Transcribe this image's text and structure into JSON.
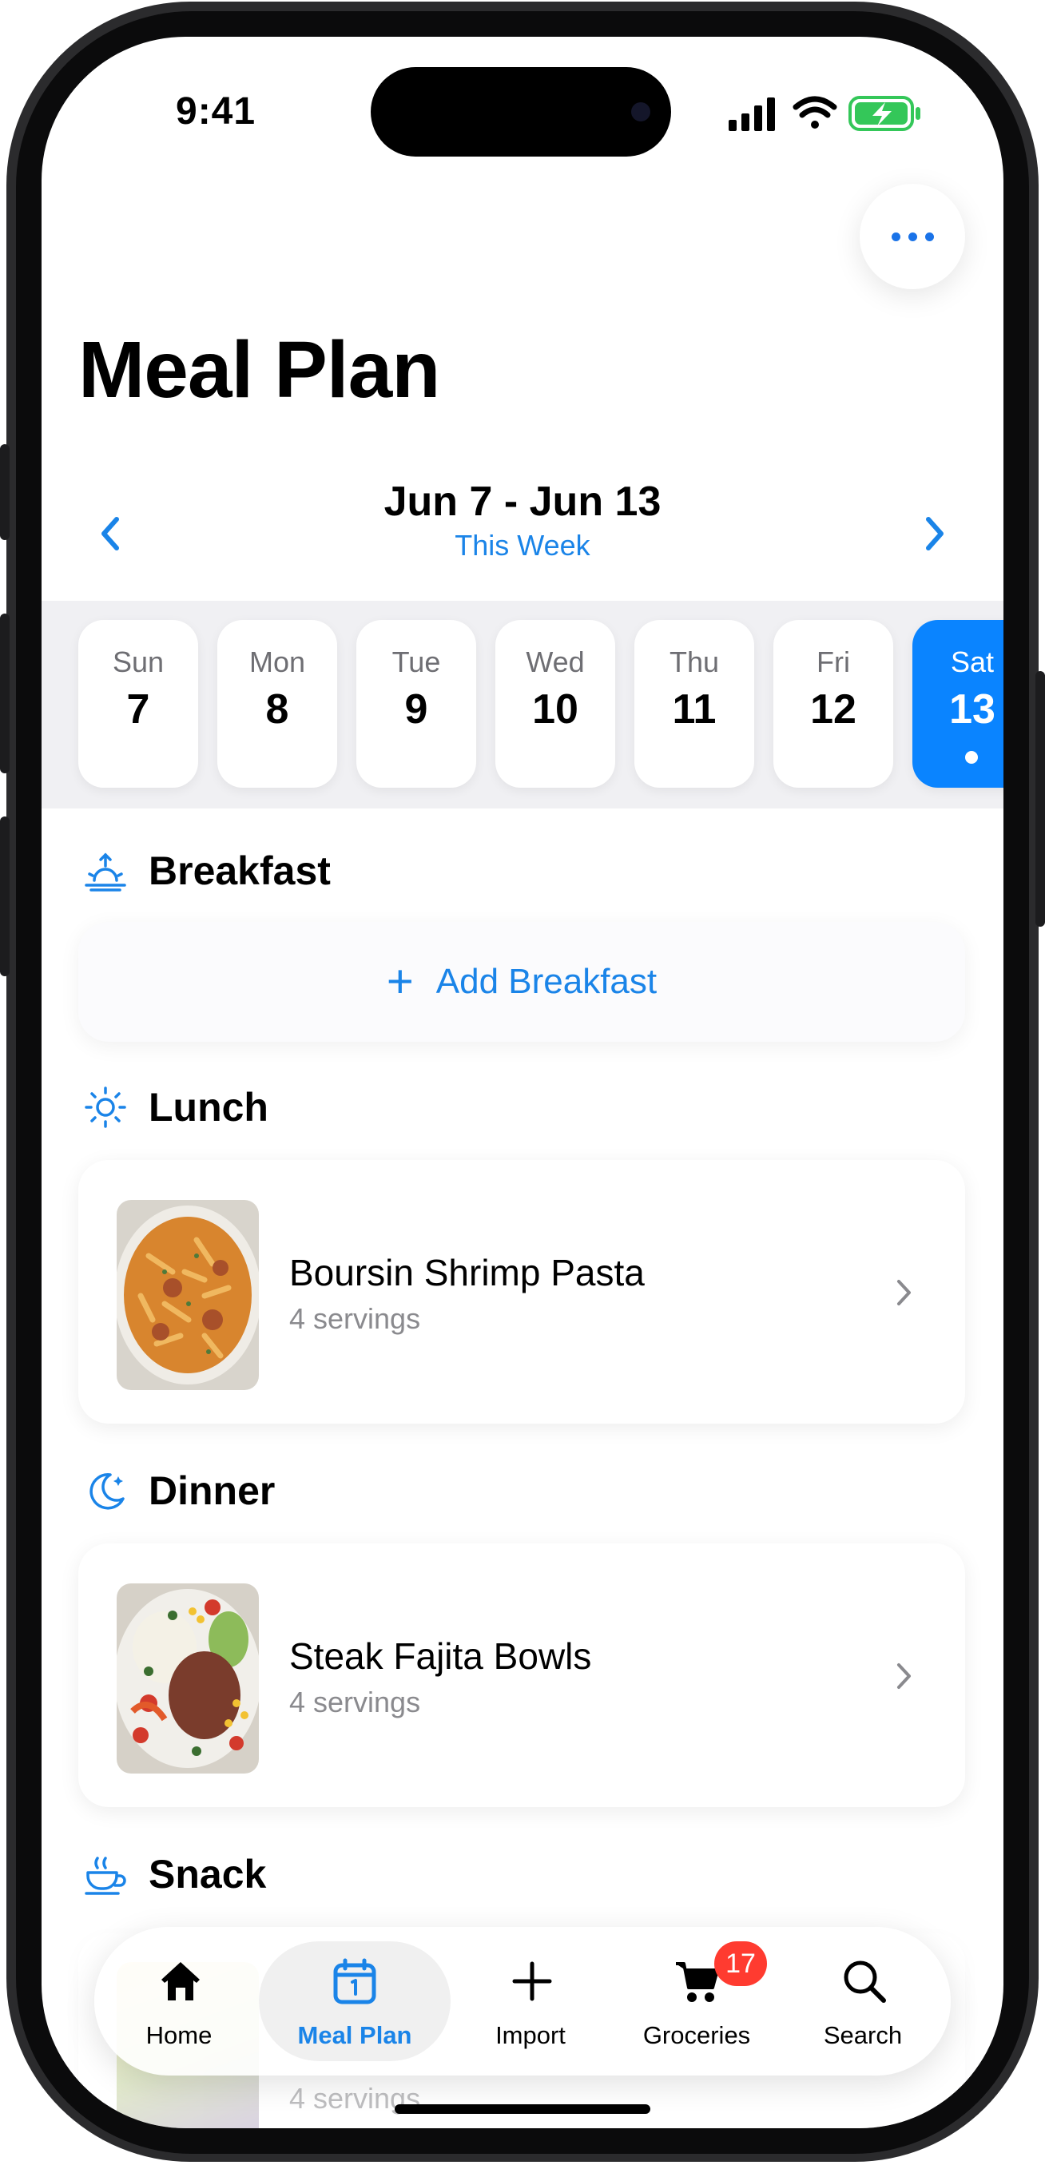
{
  "status_bar": {
    "time": "9:41"
  },
  "header": {
    "title": "Meal Plan"
  },
  "week": {
    "range": "Jun 7 - Jun 13",
    "label": "This Week"
  },
  "days": [
    {
      "name": "Sun",
      "date": "7"
    },
    {
      "name": "Mon",
      "date": "8"
    },
    {
      "name": "Tue",
      "date": "9"
    },
    {
      "name": "Wed",
      "date": "10"
    },
    {
      "name": "Thu",
      "date": "11"
    },
    {
      "name": "Fri",
      "date": "12"
    },
    {
      "name": "Sat",
      "date": "13",
      "selected": true
    }
  ],
  "sections": {
    "breakfast": {
      "title": "Breakfast",
      "add_label": "Add Breakfast",
      "icon": "sunrise-icon"
    },
    "lunch": {
      "title": "Lunch",
      "icon": "sun-icon",
      "meal": {
        "name": "Boursin Shrimp Pasta",
        "servings": "4 servings"
      }
    },
    "dinner": {
      "title": "Dinner",
      "icon": "moon-icon",
      "meal": {
        "name": "Steak Fajita Bowls",
        "servings": "4 servings"
      }
    },
    "snack": {
      "title": "Snack",
      "icon": "cup-icon",
      "meal": {
        "servings": "4 servings"
      }
    }
  },
  "tabbar": {
    "home": "Home",
    "meal_plan": "Meal Plan",
    "import": "Import",
    "groceries": "Groceries",
    "groceries_badge": "17",
    "search": "Search"
  },
  "colors": {
    "accent": "#0a84ff",
    "link": "#1a84e8",
    "badge": "#ff3b30"
  }
}
